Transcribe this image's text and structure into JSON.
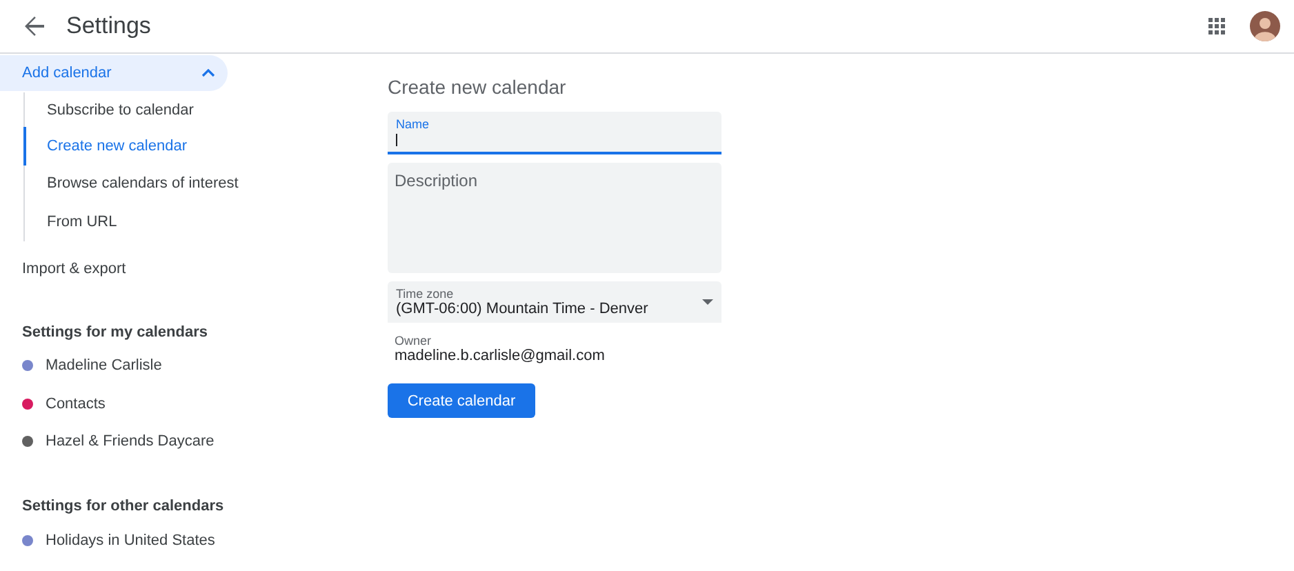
{
  "header": {
    "title": "Settings"
  },
  "sidebar": {
    "items": [
      {
        "label": "Add calendar",
        "expanded": true,
        "selected": true,
        "children": [
          {
            "label": "Subscribe to calendar",
            "selected": false
          },
          {
            "label": "Create new calendar",
            "selected": true
          },
          {
            "label": "Browse calendars of interest",
            "selected": false
          },
          {
            "label": "From URL",
            "selected": false
          }
        ]
      },
      {
        "label": "Import & export",
        "selected": false
      }
    ],
    "sections": [
      {
        "heading": "Settings for my calendars",
        "calendars": [
          {
            "name": "Madeline Carlisle",
            "color": "#7986cb"
          },
          {
            "name": "Contacts",
            "color": "#d81b60"
          },
          {
            "name": "Hazel & Friends Daycare",
            "color": "#616161"
          }
        ]
      },
      {
        "heading": "Settings for other calendars",
        "calendars": [
          {
            "name": "Holidays in United States",
            "color": "#7986cb"
          }
        ]
      }
    ]
  },
  "form": {
    "title": "Create new calendar",
    "name_field": {
      "label": "Name",
      "focused": true
    },
    "description_field": {
      "placeholder": "Description"
    },
    "time_zone": {
      "label": "Time zone",
      "value": "(GMT-06:00) Mountain Time - Denver"
    },
    "owner": {
      "label": "Owner",
      "value": "madeline.b.carlisle@gmail.com"
    },
    "button": "Create calendar"
  }
}
